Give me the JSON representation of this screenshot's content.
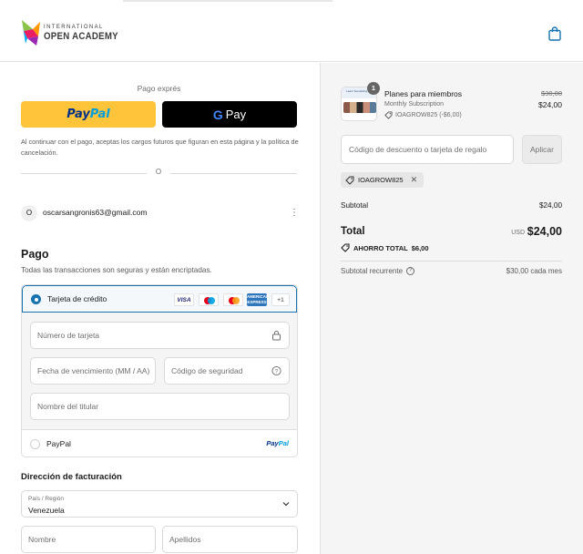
{
  "header": {
    "logo_small": "INTERNATIONAL",
    "logo_big": "OPEN ACADEMY",
    "cart_icon": "shopping-bag-icon"
  },
  "express": {
    "label": "Pago exprés",
    "paypal_pay": "Pay",
    "paypal_pal": "Pal",
    "gpay_g": "G",
    "gpay_text": "Pay",
    "terms": "Al continuar con el pago, aceptas los cargos futuros que figuran en esta página y la política de cancelación.",
    "divider": "O"
  },
  "account": {
    "avatar": "O",
    "email": "oscarsangronis63@gmail.com",
    "menu_icon": "kebab-menu-icon"
  },
  "payment": {
    "title": "Pago",
    "subtitle": "Todas las transacciones son seguras y están encriptadas.",
    "card_option": "Tarjeta de crédito",
    "brands": {
      "visa": "VISA",
      "amex": "AMERICAN EXPRESS",
      "more": "+1"
    },
    "fields": {
      "number": "Número de tarjeta",
      "expiry": "Fecha de vencimiento (MM / AA)",
      "cvv": "Código de seguridad",
      "name": "Nombre del titular"
    },
    "paypal_option": "PayPal",
    "paypal_logo_pay": "Pay",
    "paypal_logo_pal": "Pal"
  },
  "billing": {
    "title": "Dirección de facturación",
    "country_label": "País / Región",
    "country_value": "Venezuela",
    "first_name": "Nombre",
    "last_name": "Apellidos"
  },
  "summary": {
    "quantity": "1",
    "thumb_text": "Learn Something New",
    "product_name": "Planes para miembros",
    "product_sub": "Monthly Subscription",
    "product_discount": "IOAGROW825 (-$6,00)",
    "old_price": "$30,00",
    "new_price": "$24,00",
    "discount_placeholder": "Código de descuento o tarjeta de regalo",
    "apply": "Aplicar",
    "code_chip": "IOAGROW825",
    "subtotal_label": "Subtotal",
    "subtotal_value": "$24,00",
    "total_label": "Total",
    "currency": "USD",
    "total_value": "$24,00",
    "savings": "AHORRO TOTAL  $6,00",
    "recurring_label": "Subtotal recurrente",
    "recurring_value": "$30,00 cada mes"
  },
  "colors": {
    "accent": "#1773b0",
    "paypal_yellow": "#ffc439",
    "gpay_black": "#000000",
    "panel_bg": "#f5f5f5"
  }
}
